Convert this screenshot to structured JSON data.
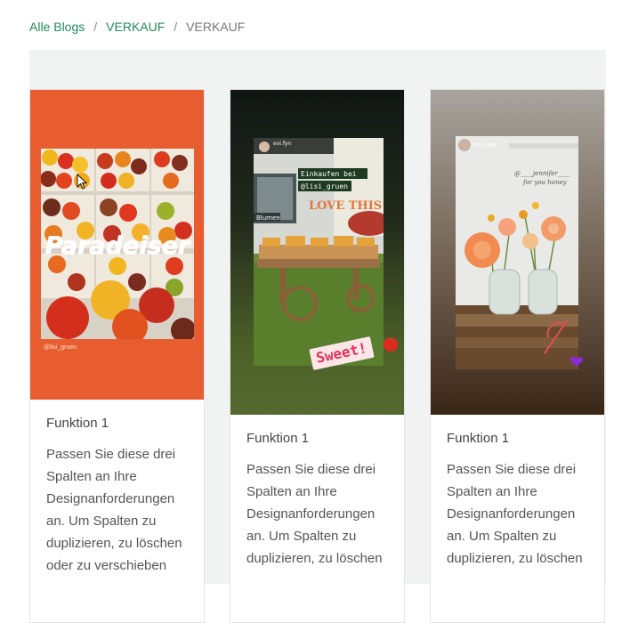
{
  "breadcrumb": {
    "items": [
      {
        "label": "Alle Blogs",
        "link": true
      },
      {
        "label": "VERKAUF",
        "link": true
      },
      {
        "label": "VERKAUF",
        "link": false
      }
    ],
    "separator": "/"
  },
  "cards": [
    {
      "title": "Funktion 1",
      "text": "Passen Sie diese drei Spalten an Ihre Designanforderungen an. Um Spalten zu duplizieren, zu löschen oder zu verschieben",
      "image": {
        "overlay_text": "Paradeiser",
        "handle": "@lisi_gruen",
        "background": "#e85d30"
      }
    },
    {
      "title": "Funktion 1",
      "text": "Passen Sie diese drei Spalten an Ihre Designanforderungen an. Um Spalten zu duplizieren, zu löschen",
      "image": {
        "user": "evi.fyn",
        "caption_line1": "Einkaufen bei",
        "caption_line2": "@lisi_gruen",
        "love_text": "LOVE THIS",
        "sticker": "Sweet!",
        "chip": "Blumen"
      }
    },
    {
      "title": "Funktion 1",
      "text": "Passen Sie diese drei Spalten an Ihre Designanforderungen an. Um Spalten zu duplizieren, zu löschen",
      "image": {
        "user": "tina.hipfl",
        "tag_line1": "@____jennifer____",
        "tag_line2": "for you honey"
      }
    }
  ],
  "colors": {
    "link": "#1f8a5a",
    "grid_bg": "#f1f3f3",
    "card1_bg": "#e85d30"
  }
}
